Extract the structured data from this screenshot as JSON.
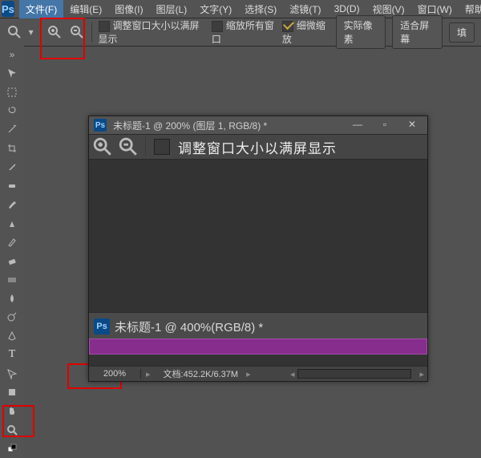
{
  "menu": {
    "items": [
      {
        "label": "文件(F)"
      },
      {
        "label": "编辑(E)"
      },
      {
        "label": "图像(I)"
      },
      {
        "label": "图层(L)"
      },
      {
        "label": "文字(Y)"
      },
      {
        "label": "选择(S)"
      },
      {
        "label": "滤镜(T)"
      },
      {
        "label": "3D(D)"
      },
      {
        "label": "视图(V)"
      },
      {
        "label": "窗口(W)"
      },
      {
        "label": "帮助(H)"
      }
    ],
    "selected_index": 0
  },
  "options": {
    "resize_windows_label": "调整窗口大小以满屏显示",
    "resize_windows_checked": false,
    "zoom_all_label": "缩放所有窗口",
    "zoom_all_checked": false,
    "scrubby_label": "细微缩放",
    "scrubby_checked": true,
    "actual_pixels_btn": "实际像素",
    "fit_screen_btn": "适合屏幕",
    "fill_btn": "填"
  },
  "tools": [
    "move",
    "marquee",
    "lasso",
    "wand",
    "crop",
    "eyedropper",
    "heal",
    "brush",
    "clone",
    "history",
    "eraser",
    "gradient",
    "blur",
    "dodge",
    "pen",
    "type",
    "path",
    "shape",
    "hand",
    "zoom",
    "swap"
  ],
  "docwin": {
    "title": "未标题-1 @ 200% (图层 1, RGB/8) *",
    "opts_label": "调整窗口大小以满屏显示",
    "nested_title": "未标题-1 @ 400%(RGB/8) *",
    "zoom": "200%",
    "status": "文档:452.2K/6.37M"
  },
  "colors": {
    "accent": "#862d8d",
    "hl": "#e00000",
    "menu_sel": "#4476a8"
  }
}
